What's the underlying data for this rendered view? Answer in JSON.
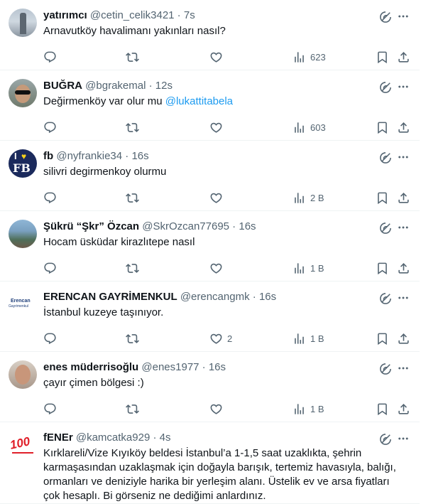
{
  "tweets": [
    {
      "name": "yatırımcı",
      "handle": "@cetin_celik3421",
      "time": "7s",
      "text": "Arnavutköy havalimanı yakınları nasıl?",
      "mention": "",
      "replies": "",
      "retweets": "",
      "likes": "",
      "views": "623",
      "avatar": "statue"
    },
    {
      "name": "BUĞRA",
      "handle": "@bgrakemal",
      "time": "12s",
      "text": "Değirmenköy var olur mu",
      "mention": "@lukattitabela",
      "replies": "",
      "retweets": "",
      "likes": "",
      "views": "603",
      "avatar": "man-sunglasses"
    },
    {
      "name": "fb",
      "handle": "@nyfrankie34",
      "time": "16s",
      "text": "silivri degirmenkoy olurmu",
      "mention": "",
      "replies": "",
      "retweets": "",
      "likes": "",
      "views": "2 B",
      "avatar": "i-love-fb",
      "avatar_text": "I",
      "avatar_text2": "FB"
    },
    {
      "name": "Şükrü “Şkr” Özcan",
      "handle": "@SkrOzcan77695",
      "time": "16s",
      "text": "Hocam üsküdar kirazlıtepe nasıl",
      "mention": "",
      "replies": "",
      "retweets": "",
      "likes": "",
      "views": "1 B",
      "avatar": "landscape"
    },
    {
      "name": "ERENCAN GAYRİMENKUL",
      "handle": "@erencangmk",
      "time": "16s",
      "text": "İstanbul kuzeye taşınıyor.",
      "mention": "",
      "replies": "",
      "retweets": "",
      "likes": "2",
      "views": "1 B",
      "avatar": "erencan-logo",
      "avatar_text": "Erencan",
      "avatar_text2": "Gayrimenkul"
    },
    {
      "name": "enes müderrisoğlu",
      "handle": "@enes1977",
      "time": "16s",
      "text": "çayır çimen bölgesi :)",
      "mention": "",
      "replies": "",
      "retweets": "",
      "likes": "",
      "views": "1 B",
      "avatar": "man-photo"
    },
    {
      "name": "fENEr",
      "handle": "@kamcatka929",
      "time": "4s",
      "text": "Kırklareli/Vize Kıyıköy beldesi İstanbul’a 1-1,5 saat uzaklıkta, şehrin karmaşasından uzaklaşmak için doğayla barışık, tertemiz havasıyla, balığı, ormanları ve deniziyle harika bir yerleşim alanı. Üstelik ev ve arsa fiyatları çok hesaplı. Bi görseniz ne dediğimi anlardınız.",
      "mention": "",
      "replies": "",
      "retweets": "",
      "likes": "",
      "views": "",
      "avatar": "emoji-100",
      "avatar_text": "100"
    }
  ],
  "icons": {
    "grok": "grok-icon",
    "more": "more-icon",
    "reply": "reply-icon",
    "retweet": "retweet-icon",
    "like": "like-icon",
    "views": "views-icon",
    "bookmark": "bookmark-icon",
    "share": "share-icon"
  },
  "colors": {
    "text": "#0f1419",
    "secondary": "#536471",
    "link": "#1d9bf0",
    "border": "#eff3f4"
  }
}
